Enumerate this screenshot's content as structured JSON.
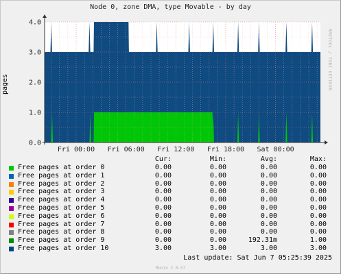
{
  "chart_data": {
    "type": "area",
    "title": "Node 0, zone DMA, type Movable - by day",
    "ylabel": "pages",
    "ylim": [
      0,
      4
    ],
    "y_ticks": [
      "0.0",
      "1.0",
      "2.0",
      "3.0",
      "4.0"
    ],
    "x_ticks": [
      "Fri 00:00",
      "Fri 06:00",
      "Fri 12:00",
      "Fri 18:00",
      "Sat 00:00"
    ],
    "x_tick_hours": [
      0,
      6,
      12,
      18,
      24
    ],
    "x_range_hours": [
      -3.8,
      29.4
    ],
    "grid": true,
    "stacked": true,
    "series": [
      {
        "name": "Free pages at order 9",
        "color": "#00cc00",
        "points": [
          [
            -3.8,
            0
          ],
          [
            -3.0,
            0
          ],
          [
            -2.9,
            1
          ],
          [
            -2.8,
            0
          ],
          [
            1.6,
            0
          ],
          [
            1.7,
            1
          ],
          [
            1.8,
            0
          ],
          [
            2.1,
            0
          ],
          [
            2.15,
            1
          ],
          [
            16.4,
            1
          ],
          [
            16.5,
            0
          ],
          [
            6.0,
            0
          ],
          [
            6.1,
            1
          ],
          [
            6.2,
            0
          ],
          [
            9.6,
            0
          ],
          [
            9.7,
            1
          ],
          [
            9.8,
            0
          ],
          [
            13.5,
            0
          ],
          [
            13.6,
            1
          ],
          [
            13.7,
            0
          ],
          [
            16.4,
            0
          ],
          [
            16.5,
            1
          ],
          [
            16.6,
            0
          ],
          [
            19.4,
            0
          ],
          [
            19.5,
            1
          ],
          [
            19.6,
            0
          ],
          [
            21.9,
            0
          ],
          [
            22.0,
            1
          ],
          [
            22.1,
            0
          ],
          [
            25.2,
            0
          ],
          [
            25.3,
            1
          ],
          [
            25.4,
            0
          ],
          [
            28.3,
            0
          ],
          [
            28.4,
            1
          ],
          [
            28.5,
            0
          ],
          [
            29.4,
            0
          ]
        ]
      },
      {
        "name": "Free pages at order 10",
        "color": "#0f4a80",
        "points": [
          [
            -3.8,
            3
          ],
          [
            -3.1,
            3
          ],
          [
            -3.0,
            4
          ],
          [
            -2.9,
            3
          ],
          [
            1.5,
            3
          ],
          [
            1.6,
            4
          ],
          [
            1.7,
            3
          ],
          [
            2.1,
            3
          ],
          [
            2.15,
            4
          ],
          [
            6.3,
            4
          ],
          [
            6.35,
            3
          ],
          [
            9.6,
            3
          ],
          [
            9.7,
            4
          ],
          [
            9.8,
            3
          ],
          [
            13.5,
            3
          ],
          [
            13.6,
            4
          ],
          [
            13.7,
            3
          ],
          [
            16.4,
            3
          ],
          [
            16.5,
            4
          ],
          [
            16.6,
            3
          ],
          [
            19.4,
            3
          ],
          [
            19.5,
            4
          ],
          [
            19.6,
            3
          ],
          [
            21.9,
            3
          ],
          [
            22.0,
            4
          ],
          [
            22.1,
            3
          ],
          [
            25.2,
            3
          ],
          [
            25.3,
            4
          ],
          [
            25.4,
            3
          ],
          [
            28.3,
            3
          ],
          [
            28.4,
            4
          ],
          [
            28.5,
            3
          ],
          [
            29.4,
            3
          ]
        ]
      }
    ]
  },
  "legend": {
    "headers": {
      "cur": "Cur:",
      "min": "Min:",
      "avg": "Avg:",
      "max": "Max:"
    },
    "rows": [
      {
        "label": "Free pages at order  0",
        "color": "#00cc00",
        "cur": "0.00",
        "min": "0.00",
        "avg": "0.00",
        "max": "0.00"
      },
      {
        "label": "Free pages at order  1",
        "color": "#0066b3",
        "cur": "0.00",
        "min": "0.00",
        "avg": "0.00",
        "max": "0.00"
      },
      {
        "label": "Free pages at order  2",
        "color": "#ff8000",
        "cur": "0.00",
        "min": "0.00",
        "avg": "0.00",
        "max": "0.00"
      },
      {
        "label": "Free pages at order  3",
        "color": "#ffcc00",
        "cur": "0.00",
        "min": "0.00",
        "avg": "0.00",
        "max": "0.00"
      },
      {
        "label": "Free pages at order  4",
        "color": "#330099",
        "cur": "0.00",
        "min": "0.00",
        "avg": "0.00",
        "max": "0.00"
      },
      {
        "label": "Free pages at order  5",
        "color": "#990099",
        "cur": "0.00",
        "min": "0.00",
        "avg": "0.00",
        "max": "0.00"
      },
      {
        "label": "Free pages at order  6",
        "color": "#ccff00",
        "cur": "0.00",
        "min": "0.00",
        "avg": "0.00",
        "max": "0.00"
      },
      {
        "label": "Free pages at order  7",
        "color": "#ff0000",
        "cur": "0.00",
        "min": "0.00",
        "avg": "0.00",
        "max": "0.00"
      },
      {
        "label": "Free pages at order  8",
        "color": "#808080",
        "cur": "0.00",
        "min": "0.00",
        "avg": "0.00",
        "max": "0.00"
      },
      {
        "label": "Free pages at order  9",
        "color": "#008f00",
        "cur": "0.00",
        "min": "0.00",
        "avg": "192.31m",
        "max": "1.00"
      },
      {
        "label": "Free pages at order 10",
        "color": "#00487d",
        "cur": "3.00",
        "min": "3.00",
        "avg": "3.00",
        "max": "3.00"
      }
    ]
  },
  "last_update": "Last update: Sat Jun  7 05:25:39 2025",
  "watermark": "RRDTOOL / TOBI OETIKER",
  "version": "Munin 2.0.57"
}
